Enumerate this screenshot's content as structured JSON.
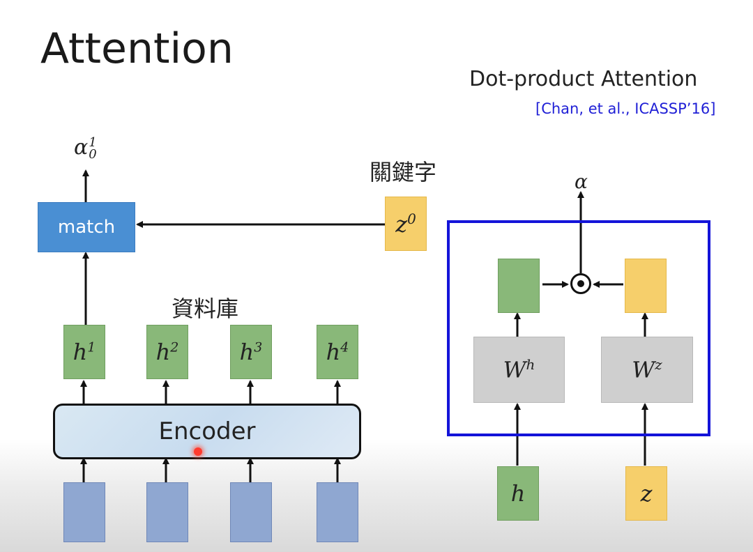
{
  "slide": {
    "title": "Attention",
    "subtitle": "Dot-product Attention",
    "citation": "[Chan, et al., ICASSP’16]"
  },
  "left": {
    "alpha_label": "α",
    "alpha_sub": "0",
    "alpha_sup": "1",
    "match_label": "match",
    "keyword_label": "關鍵字",
    "z0_base": "z",
    "z0_sup": "0",
    "database_label": "資料庫",
    "hidden_states": [
      {
        "base": "h",
        "sup": "1"
      },
      {
        "base": "h",
        "sup": "2"
      },
      {
        "base": "h",
        "sup": "3"
      },
      {
        "base": "h",
        "sup": "4"
      }
    ],
    "encoder_label": "Encoder"
  },
  "right": {
    "alpha_label": "α",
    "wh_base": "W",
    "wh_sup": "h",
    "wz_base": "W",
    "wz_sup": "z",
    "h_input": "h",
    "z_input": "z"
  },
  "colors": {
    "match": "#4a8fd3",
    "hidden": "#89b879",
    "query": "#f6cf6b",
    "input": "#8fa7d1",
    "weight": "#cfcfcf",
    "frame": "#1414d9",
    "citation": "#1f1fd6"
  }
}
